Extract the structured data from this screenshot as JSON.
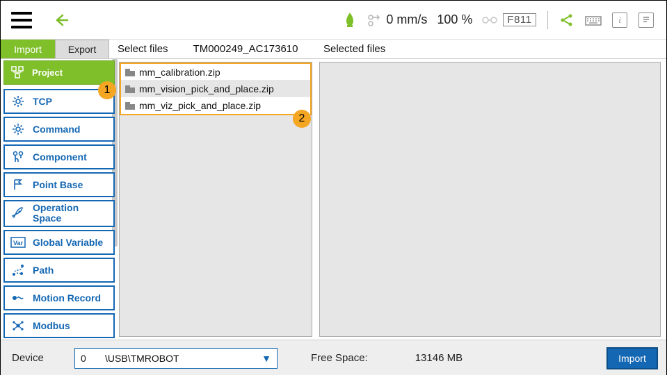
{
  "topbar": {
    "speed": "0 mm/s",
    "percent": "100 %",
    "code": "F811"
  },
  "tabs": {
    "import": "Import",
    "export": "Export",
    "select_files_label": "Select files",
    "file_set_id": "TM000249_AC173610",
    "selected_files_label": "Selected files"
  },
  "sidebar": {
    "items": [
      {
        "label": "Project",
        "active": true
      },
      {
        "label": "TCP"
      },
      {
        "label": "Command"
      },
      {
        "label": "Component"
      },
      {
        "label": "Point Base"
      },
      {
        "label": "Operation Space"
      },
      {
        "label": "Global Variable"
      },
      {
        "label": "Path"
      },
      {
        "label": "Motion Record"
      },
      {
        "label": "Modbus"
      }
    ]
  },
  "files": {
    "available": [
      "mm_calibration.zip",
      "mm_vision_pick_and_place.zip",
      "mm_viz_pick_and_place.zip"
    ]
  },
  "bottom": {
    "device_label": "Device",
    "device_value": "0       \\USB\\TMROBOT",
    "free_space_label": "Free Space:",
    "free_space_value": "13146 MB",
    "import_button": "Import"
  },
  "callouts": {
    "one": "1",
    "two": "2"
  }
}
